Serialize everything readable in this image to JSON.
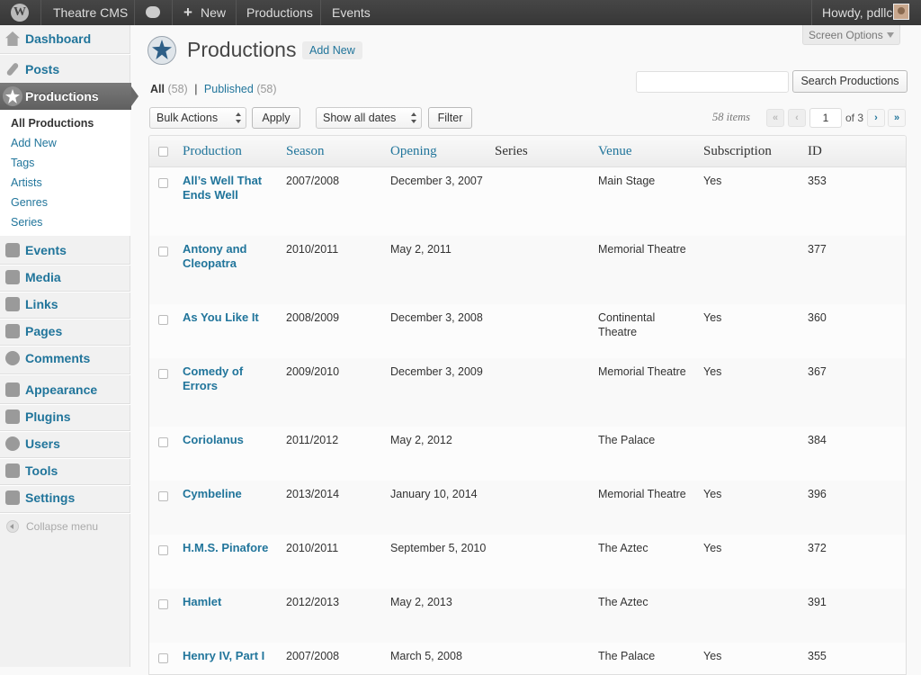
{
  "adminbar": {
    "site_name": "Theatre CMS",
    "new_label": "New",
    "productions_label": "Productions",
    "events_label": "Events",
    "howdy": "Howdy, pdllc"
  },
  "sidebar": {
    "items": [
      {
        "label": "Dashboard",
        "icon": "house-icon"
      },
      {
        "label": "Posts",
        "icon": "pin-icon"
      },
      {
        "label": "Productions",
        "icon": "star-icon"
      },
      {
        "label": "Events",
        "icon": "events-icon"
      },
      {
        "label": "Media",
        "icon": "media-icon"
      },
      {
        "label": "Links",
        "icon": "links-icon"
      },
      {
        "label": "Pages",
        "icon": "pages-icon"
      },
      {
        "label": "Comments",
        "icon": "comments-icon"
      },
      {
        "label": "Appearance",
        "icon": "appearance-icon"
      },
      {
        "label": "Plugins",
        "icon": "plugins-icon"
      },
      {
        "label": "Users",
        "icon": "users-icon"
      },
      {
        "label": "Tools",
        "icon": "tools-icon"
      },
      {
        "label": "Settings",
        "icon": "settings-icon"
      }
    ],
    "submenu": [
      "All Productions",
      "Add New",
      "Tags",
      "Artists",
      "Genres",
      "Series"
    ],
    "collapse_label": "Collapse menu"
  },
  "page": {
    "title": "Productions",
    "add_new": "Add New",
    "screen_options": "Screen Options",
    "views": {
      "all": "All",
      "all_count": "(58)",
      "sep": "|",
      "published": "Published",
      "published_count": "(58)"
    },
    "search_button": "Search Productions",
    "search_value": "",
    "bulk_actions": "Bulk Actions",
    "apply": "Apply",
    "dates": "Show all dates",
    "filter": "Filter",
    "items_count": "58 items",
    "first": "«",
    "prev": "‹",
    "next": "›",
    "last": "»",
    "current_page": "1",
    "of_pages": "of 3"
  },
  "table": {
    "columns": [
      "Production",
      "Season",
      "Opening",
      "Series",
      "Venue",
      "Subscription",
      "ID"
    ],
    "rows": [
      {
        "production": "All’s Well That Ends Well",
        "season": "2007/2008",
        "opening": "December 3, 2007",
        "series": "",
        "venue": "Main Stage",
        "subscription": "Yes",
        "id": "353"
      },
      {
        "production": "Antony and Cleopatra",
        "season": "2010/2011",
        "opening": "May 2, 2011",
        "series": "",
        "venue": "Memorial Theatre",
        "subscription": "",
        "id": "377"
      },
      {
        "production": "As You Like It",
        "season": "2008/2009",
        "opening": "December 3, 2008",
        "series": "",
        "venue": "Continental Theatre",
        "subscription": "Yes",
        "id": "360"
      },
      {
        "production": "Comedy of Errors",
        "season": "2009/2010",
        "opening": "December 3, 2009",
        "series": "",
        "venue": "Memorial Theatre",
        "subscription": "Yes",
        "id": "367"
      },
      {
        "production": "Coriolanus",
        "season": "2011/2012",
        "opening": "May 2, 2012",
        "series": "",
        "venue": "The Palace",
        "subscription": "",
        "id": "384"
      },
      {
        "production": "Cymbeline",
        "season": "2013/2014",
        "opening": "January 10, 2014",
        "series": "",
        "venue": "Memorial Theatre",
        "subscription": "Yes",
        "id": "396"
      },
      {
        "production": "H.M.S. Pinafore",
        "season": "2010/2011",
        "opening": "September 5, 2010",
        "series": "",
        "venue": "The Aztec",
        "subscription": "Yes",
        "id": "372"
      },
      {
        "production": "Hamlet",
        "season": "2012/2013",
        "opening": "May 2, 2013",
        "series": "",
        "venue": "The Aztec",
        "subscription": "",
        "id": "391"
      },
      {
        "production": "Henry IV, Part I",
        "season": "2007/2008",
        "opening": "March 5, 2008",
        "series": "",
        "venue": "The Palace",
        "subscription": "Yes",
        "id": "355"
      }
    ]
  },
  "colors": {
    "link": "#21759b",
    "adminbar": "#464646",
    "current_menu": "#6d6d6d"
  }
}
